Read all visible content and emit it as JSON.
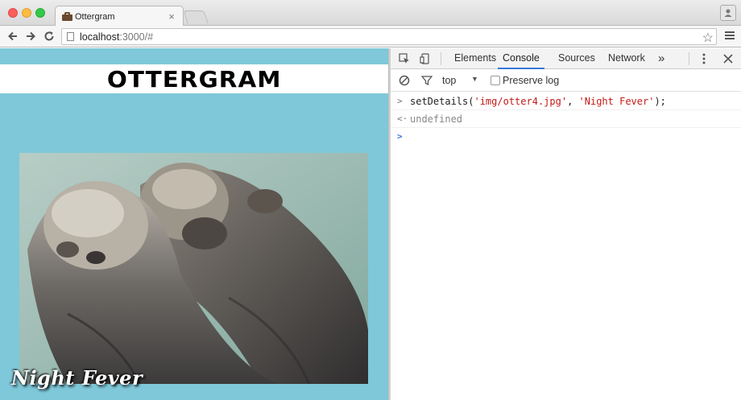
{
  "browser": {
    "tab_title": "Ottergram",
    "tab_close": "×",
    "url_host": "localhost",
    "url_rest": ":3000/#"
  },
  "page": {
    "logo": "OTTERGRAM",
    "detail_title": "Night Fever"
  },
  "devtools": {
    "tabs": [
      "Elements",
      "Console",
      "Sources",
      "Network"
    ],
    "active_tab": "Console",
    "more": "»",
    "context": "top",
    "preserve_log": "Preserve log",
    "console": {
      "call_fn": "setDetails(",
      "arg1": "'img/otter4.jpg'",
      "sep": ", ",
      "arg2": "'Night Fever'",
      "call_end": ");",
      "result": "undefined"
    }
  },
  "colors": {
    "page_bg": "#7ec8d9",
    "accent": "#3879d9",
    "string": "#c41a16"
  }
}
